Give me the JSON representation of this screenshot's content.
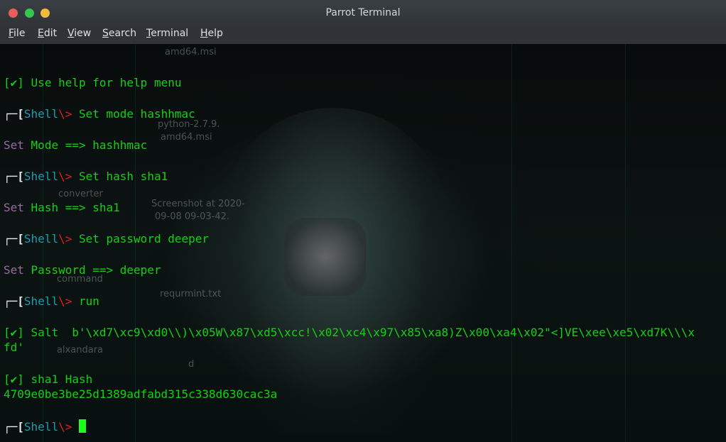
{
  "window": {
    "title": "Parrot Terminal",
    "menu": [
      {
        "first": "F",
        "rest": "ile"
      },
      {
        "first": "E",
        "rest": "dit"
      },
      {
        "first": "V",
        "rest": "iew"
      },
      {
        "first": "S",
        "rest": "earch"
      },
      {
        "first": "T",
        "rest": "erminal"
      },
      {
        "first": "H",
        "rest": "elp"
      }
    ]
  },
  "desktop_labels": [
    "amd64.msi",
    "python-2.7.9.",
    "amd64.msi",
    "converter",
    "Screenshot at 2020-",
    "09-08 09-03-42.",
    "command",
    "requrmint.txt",
    "alxandara",
    "d"
  ],
  "terminal": {
    "prompt_open": "┌─[",
    "prompt_name": "Shell",
    "prompt_sep": "\\>",
    "check": "[✔]",
    "help_line": "Use help for help menu",
    "cmd1": "Set mode hashhmac",
    "out1_key": "Set",
    "out1_val": "Mode ==> hashhmac",
    "cmd2": "Set hash sha1",
    "out2_key": "Set",
    "out2_val": "Hash ==> sha1",
    "cmd3": "Set password deeper",
    "out3_key": "Set",
    "out3_val": "Password ==> deeper",
    "cmd4": "run",
    "salt_line": "Salt  b'\\xd7\\xc9\\xd0\\\\)\\x05W\\x87\\xd5\\xcc!\\x02\\xc4\\x97\\x85\\xa8)Z\\x00\\xa4\\x02\"<]VE\\xee\\xe5\\xd7K\\\\\\x",
    "salt_cont": "fd'",
    "hash_label": "sha1 Hash",
    "hash_value": "4709e0be3be25d1389adfabd315c338d630cac3a"
  },
  "colors": {
    "green": "#13d113",
    "cyan": "#1e9bb0",
    "red": "#e02020",
    "purple": "#9a6aa0"
  }
}
